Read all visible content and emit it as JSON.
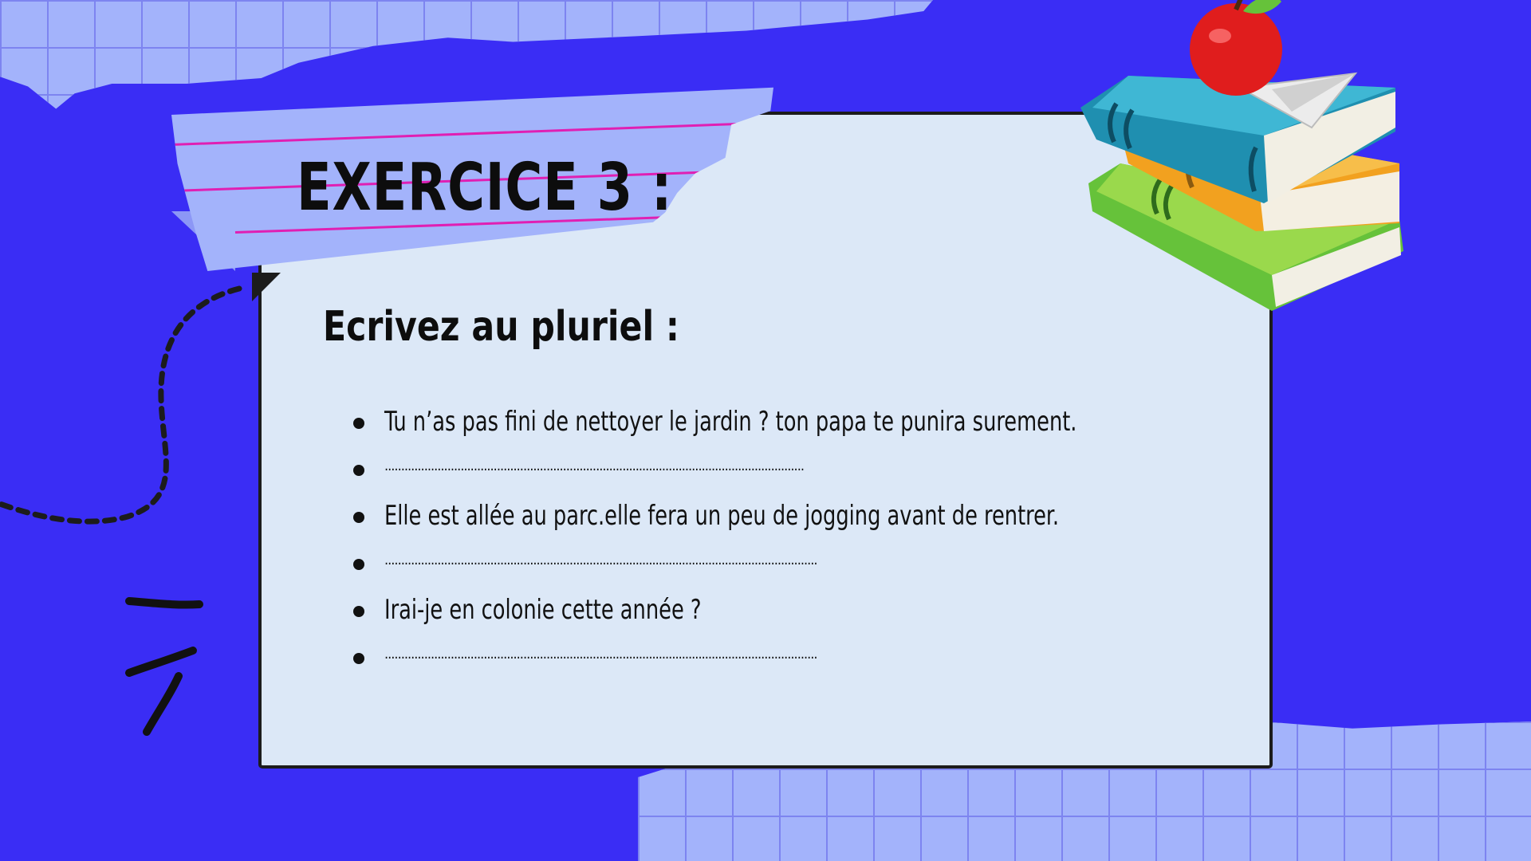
{
  "header": {
    "title": "EXERCICE 3 :"
  },
  "instruction": "Ecrivez au pluriel :",
  "items": [
    {
      "text": "Tu n’as pas fini de nettoyer le jardin ? ton papa te punira surement."
    },
    {
      "text": "..............................................................................................................................."
    },
    {
      "text": "Elle est allée au parc.elle fera un peu de jogging avant de rentrer."
    },
    {
      "text": "..................................................................................................................................."
    },
    {
      "text": "Irai-je en colonie cette année ?"
    },
    {
      "text": "..................................................................................................................................."
    }
  ],
  "colors": {
    "background": "#3a2df5",
    "grid_paper": "#a3b3fb",
    "card": "#dce8f7",
    "tape": "#a3b3fb",
    "tape_lines": "#e01fb3",
    "text": "#0d0d0d"
  },
  "decorations": [
    "grid-paper-scrap",
    "notebook-tape",
    "dashed-curve",
    "scribble-marks",
    "book-stack-icon",
    "apple-icon",
    "paper-plane-icon"
  ]
}
